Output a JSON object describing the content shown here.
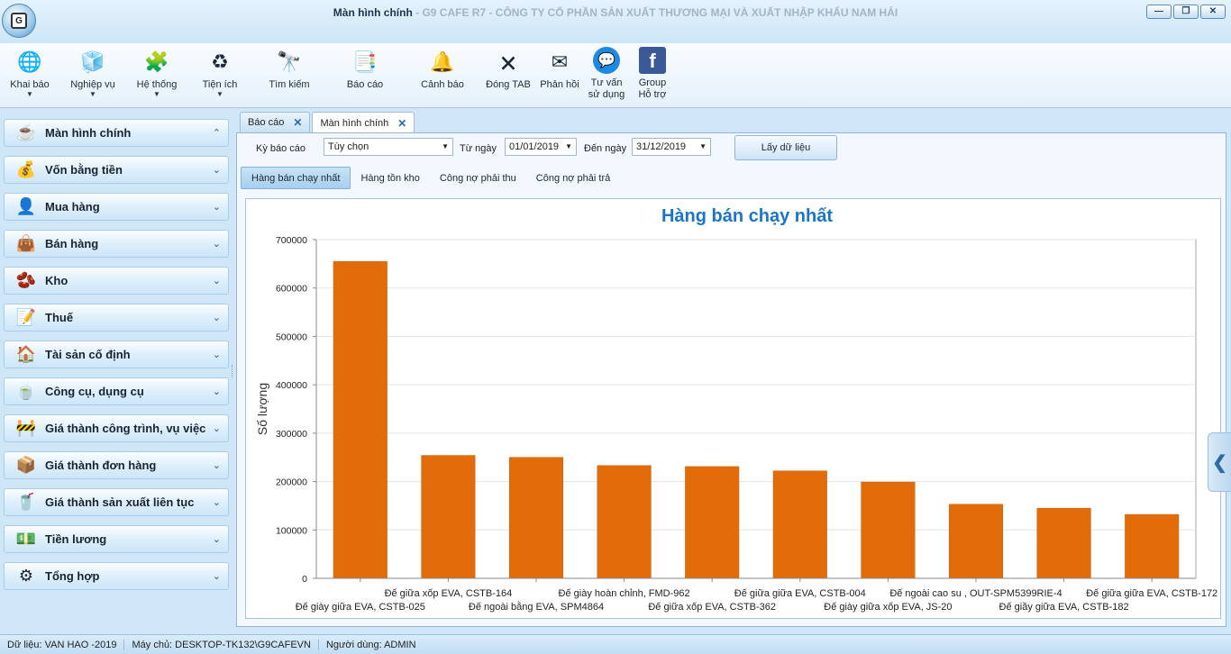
{
  "window": {
    "title_main": "Màn hình chính",
    "title_sub": " - G9 CAFE R7 - CÔNG TY CỔ PHẦN SẢN XUẤT THƯƠNG MẠI VÀ XUẤT NHẬP KHẨU NAM HẢI",
    "app_logo": "G",
    "minimize": "—",
    "restore": "❐",
    "close": "✕"
  },
  "ribbon": [
    {
      "label": "Khai báo",
      "icon": "globe-icon",
      "glyph": "🌐",
      "dropdown": true
    },
    {
      "label": "Nghiệp vụ",
      "icon": "cube-icon",
      "glyph": "🧊",
      "dropdown": true
    },
    {
      "label": "Hệ thống",
      "icon": "blocks-icon",
      "glyph": "🧩",
      "dropdown": true
    },
    {
      "label": "Tiện ích",
      "icon": "recycle-icon",
      "glyph": "♻",
      "dropdown": true
    },
    {
      "label": "Tìm kiếm",
      "icon": "binoculars-icon",
      "glyph": "🔭",
      "dropdown": false
    },
    {
      "label": "Báo cáo",
      "icon": "report-icon",
      "glyph": "📑",
      "dropdown": false
    },
    {
      "label": "Cảnh báo",
      "icon": "bell-icon",
      "glyph": "🔔",
      "dropdown": false
    },
    {
      "label": "Đóng TAB",
      "icon": "close-tab-icon",
      "glyph": "🗙",
      "dropdown": false
    },
    {
      "label": "Phản hồi",
      "icon": "mail-icon",
      "glyph": "✉",
      "dropdown": false
    },
    {
      "label": "Tư vấn\nsử dụng",
      "icon": "messenger-icon",
      "glyph": "💬",
      "dropdown": false
    },
    {
      "label": "Group\nHỗ trợ",
      "icon": "facebook-icon",
      "glyph": "f",
      "dropdown": false
    }
  ],
  "nav": [
    {
      "label": "Màn hình chính",
      "icon": "coffee-grinder-icon",
      "glyph": "☕",
      "chevron": "⌃"
    },
    {
      "label": "Vốn bằng tiền",
      "icon": "money-bag-icon",
      "glyph": "💰",
      "chevron": "⌄"
    },
    {
      "label": "Mua hàng",
      "icon": "buyer-icon",
      "glyph": "👤",
      "chevron": "⌄"
    },
    {
      "label": "Bán hàng",
      "icon": "bag-icon",
      "glyph": "👜",
      "chevron": "⌄"
    },
    {
      "label": "Kho",
      "icon": "coffee-beans-icon",
      "glyph": "🫘",
      "chevron": "⌄"
    },
    {
      "label": "Thuế",
      "icon": "checklist-icon",
      "glyph": "📝",
      "chevron": "⌄"
    },
    {
      "label": "Tài sản cố định",
      "icon": "house-icon",
      "glyph": "🏠",
      "chevron": "⌄"
    },
    {
      "label": "Công cụ, dụng cụ",
      "icon": "coffee-filter-icon",
      "glyph": "🍵",
      "chevron": "⌄"
    },
    {
      "label": "Giá thành công trình, vụ việc",
      "icon": "construction-icon",
      "glyph": "🚧",
      "chevron": "⌄"
    },
    {
      "label": "Giá thành đơn hàng",
      "icon": "order-icon",
      "glyph": "📦",
      "chevron": "⌄"
    },
    {
      "label": "Giá thành sản xuất liên tục",
      "icon": "cup-icon",
      "glyph": "🥤",
      "chevron": "⌄"
    },
    {
      "label": "Tiền lương",
      "icon": "salary-icon",
      "glyph": "💵",
      "chevron": "⌄"
    },
    {
      "label": "Tổng hợp",
      "icon": "coffee-machine-icon",
      "glyph": "⚙",
      "chevron": "⌄"
    }
  ],
  "doc_tabs": [
    {
      "label": "Báo cáo",
      "close": "✕",
      "active": false
    },
    {
      "label": "Màn hình chính",
      "close": "✕",
      "active": true
    }
  ],
  "filters": {
    "period_label": "Kỳ báo cáo",
    "period_value": "Tùy chọn",
    "from_label": "Từ ngày",
    "from_value": "01/01/2019",
    "to_label": "Đến ngày",
    "to_value": "31/12/2019",
    "fetch_button": "Lấy dữ liệu",
    "dropdown_glyph": "▼"
  },
  "sub_tabs": [
    {
      "label": "Hàng bán chạy nhất",
      "active": true
    },
    {
      "label": "Hàng tồn kho",
      "active": false
    },
    {
      "label": "Công nợ phải thu",
      "active": false
    },
    {
      "label": "Công nợ phải trả",
      "active": false
    }
  ],
  "chart_data": {
    "type": "bar",
    "title": "Hàng bán chạy nhất",
    "xlabel": "",
    "ylabel": "Số lượng",
    "ylim": [
      0,
      700000
    ],
    "yticks": [
      0,
      100000,
      200000,
      300000,
      400000,
      500000,
      600000,
      700000
    ],
    "grid": true,
    "bar_color": "#e26b0a",
    "title_color": "#1a75c9",
    "categories": [
      "Đế giày giữa EVA, CSTB-025",
      "Đế giữa xốp EVA, CSTB-164",
      "Đế ngoài bằng EVA, SPM4864",
      "Đế giày hoàn chỉnh, FMD-962",
      "Đế giữa xốp EVA, CSTB-362",
      "Đế giữa giữa EVA, CSTB-004",
      "Đế giày giữa xốp EVA, JS-20",
      "Đế ngoài cao su , OUT-SPM5399RIE-4",
      "Đế giầy giữa EVA, CSTB-182",
      "Đế giữa giữa EVA, CSTB-172"
    ],
    "values": [
      655000,
      254000,
      250000,
      233000,
      231000,
      222000,
      199000,
      153000,
      145000,
      132000
    ]
  },
  "side_handle": "❮",
  "status": {
    "data": "Dữ liệu: VAN HAO -2019",
    "server": "Máy chủ: DESKTOP-TK132\\G9CAFEVN",
    "user": "Người dùng: ADMIN"
  }
}
